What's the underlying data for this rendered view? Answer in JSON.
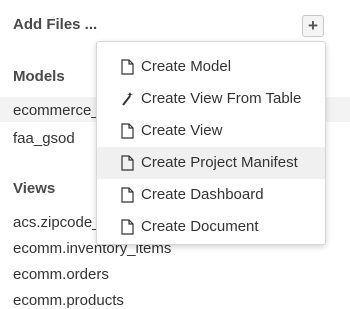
{
  "header": {
    "title": "Add Files ...",
    "add_button": "+"
  },
  "models": {
    "title": "Models",
    "items": [
      "ecommerce_",
      "faa_gsod"
    ]
  },
  "views": {
    "title": "Views",
    "items": [
      "acs.zipcode_",
      "ecomm.inventory_items",
      "ecomm.orders",
      "ecomm.products"
    ]
  },
  "menu": {
    "items": [
      {
        "label": "Create Model",
        "icon": "file-icon"
      },
      {
        "label": "Create View From Table",
        "icon": "magic-wand-icon"
      },
      {
        "label": "Create View",
        "icon": "file-icon"
      },
      {
        "label": "Create Project Manifest",
        "icon": "file-icon"
      },
      {
        "label": "Create Dashboard",
        "icon": "file-icon"
      },
      {
        "label": "Create Document",
        "icon": "file-icon"
      }
    ]
  }
}
